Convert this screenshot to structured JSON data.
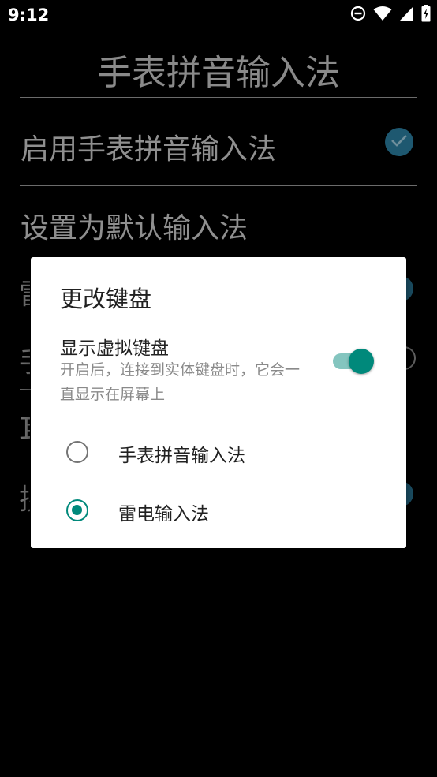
{
  "status_bar": {
    "time": "9:12",
    "icons": [
      "do-not-disturb-icon",
      "wifi-icon",
      "cell-signal-icon",
      "battery-charging-icon"
    ]
  },
  "app": {
    "title": "手表拼音输入法",
    "settings": [
      {
        "label": "启用手表拼音输入法",
        "control": "checkbox-checked"
      },
      {
        "label": "设置为默认输入法"
      }
    ],
    "accent_color": "#1e5870"
  },
  "dialog": {
    "title": "更改键盘",
    "virtual_keyboard": {
      "label": "显示虚拟键盘",
      "description": "开启后，连接到实体键盘时，它会一直显示在屏幕上",
      "enabled": true
    },
    "options": [
      {
        "label": "手表拼音输入法",
        "selected": false
      },
      {
        "label": "雷电输入法",
        "selected": true
      }
    ],
    "accent_color": "#00897b"
  }
}
